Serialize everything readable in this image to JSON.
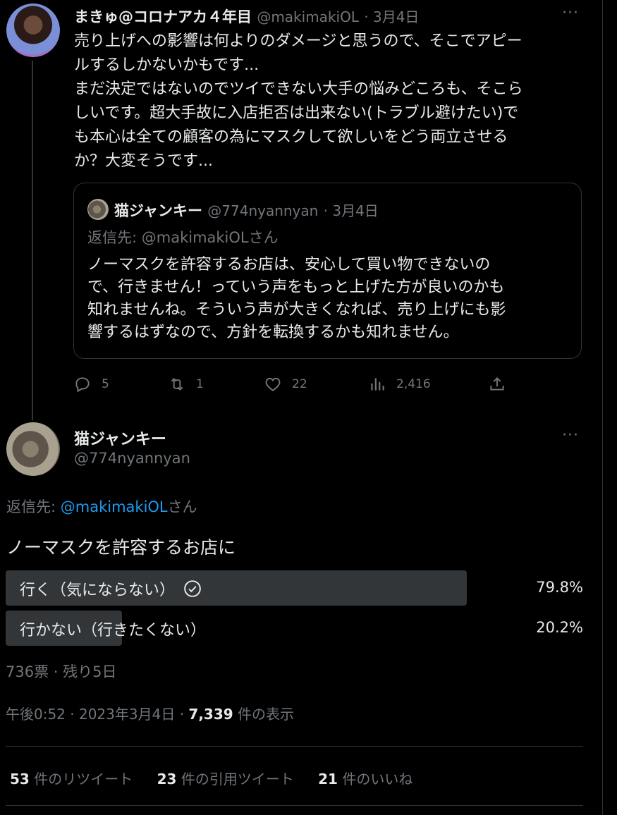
{
  "tweet1": {
    "display_name": "まきゅ@コロナアカ４年目",
    "handle": "@makimakiOL",
    "date": "· 3月4日",
    "more": "···",
    "body": "売り上げへの影響は何よりのダメージと思うので、そこでアピー\nルするしかないかもです...\nまだ決定ではないのでツイできない大手の悩みどころも、そこら\nしいです。超大手故に入店拒否は出来ない(トラブル避けたい)で\nも本心は全ての顧客の為にマスクして欲しいをどう両立させる\nか？大変そうです...",
    "quote": {
      "display_name": "猫ジャンキー",
      "handle": "@774nyannyan",
      "date": "· 3月4日",
      "reply_to": "返信先: @makimakiOLさん",
      "body": "ノーマスクを許容するお店は、安心して買い物できないの\nで、行きません！っていう声をもっと上げた方が良いのかも\n知れませんね。そういう声が大きくなれば、売り上げにも影\n響するはずなので、方針を転換するかも知れません。"
    },
    "actions": {
      "replies": "5",
      "retweets": "1",
      "likes": "22",
      "views": "2,416"
    }
  },
  "tweet2": {
    "display_name": "猫ジャンキー",
    "handle": "@774nyannyan",
    "more": "···",
    "reply_prefix": "返信先: ",
    "reply_link": "@makimakiOL",
    "reply_suffix": "さん",
    "body": "ノーマスクを許容するお店に",
    "poll": {
      "options": [
        {
          "label": "行く（気にならない）",
          "percent": "79.8%",
          "fraction": 0.798,
          "selected": true
        },
        {
          "label": "行かない（行きたくない）",
          "percent": "20.2%",
          "fraction": 0.202,
          "selected": false
        }
      ],
      "meta": "736票 · 残り5日"
    },
    "timestamp_prefix": "午後0:52 · 2023年3月4日 · ",
    "views_count": "7,339",
    "views_suffix": " 件の表示",
    "stats": [
      {
        "count": "53",
        "label": " 件のリツイート"
      },
      {
        "count": "23",
        "label": " 件の引用ツイート"
      },
      {
        "count": "21",
        "label": " 件のいいね"
      }
    ]
  },
  "colors": {
    "background": "#000000",
    "text": "#e7e9ea",
    "muted": "#71767b",
    "link": "#1d9bf0",
    "poll_fill": "#333639",
    "border": "#2f3336"
  },
  "icons": [
    "reply-icon",
    "retweet-icon",
    "like-icon",
    "views-icon",
    "share-icon",
    "check-circle-icon",
    "more-icon"
  ]
}
